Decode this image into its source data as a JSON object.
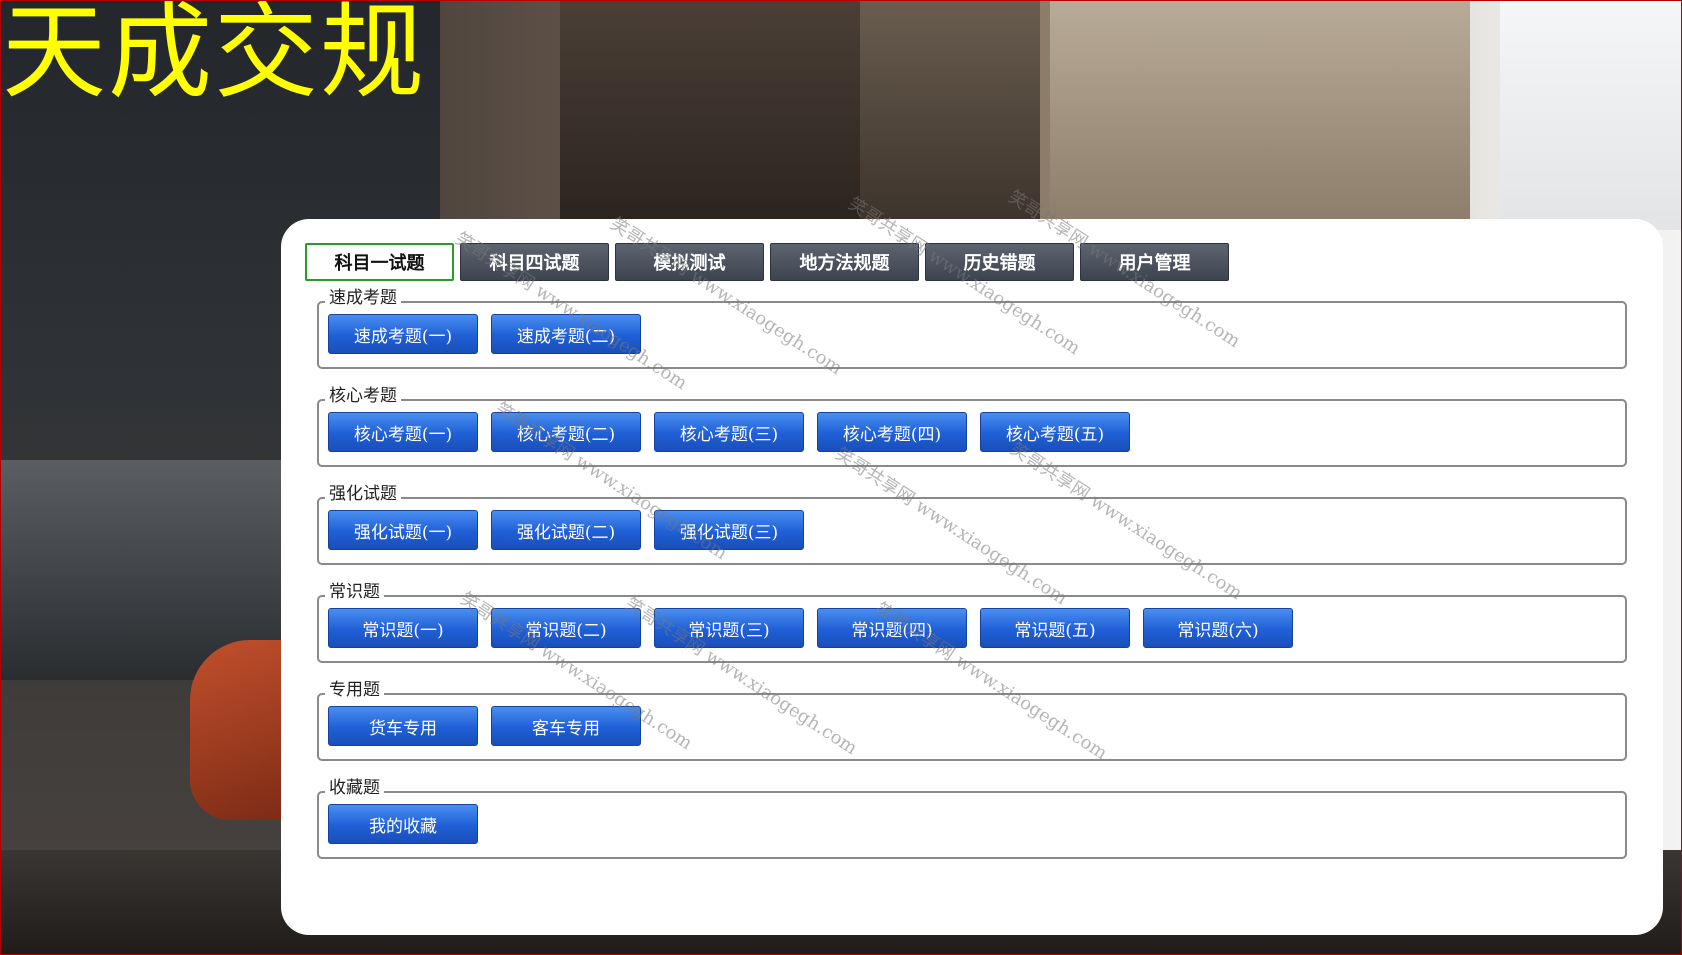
{
  "app": {
    "logo_text": "天成交规"
  },
  "tabs": [
    {
      "label": "科目一试题",
      "active": true
    },
    {
      "label": "科目四试题",
      "active": false
    },
    {
      "label": "模拟测试",
      "active": false
    },
    {
      "label": "地方法规题",
      "active": false
    },
    {
      "label": "历史错题",
      "active": false
    },
    {
      "label": "用户管理",
      "active": false
    }
  ],
  "groups": [
    {
      "legend": "速成考题",
      "buttons": [
        "速成考题(一)",
        "速成考题(二)"
      ]
    },
    {
      "legend": "核心考题",
      "buttons": [
        "核心考题(一)",
        "核心考题(二)",
        "核心考题(三)",
        "核心考题(四)",
        "核心考题(五)"
      ]
    },
    {
      "legend": "强化试题",
      "buttons": [
        "强化试题(一)",
        "强化试题(二)",
        "强化试题(三)"
      ]
    },
    {
      "legend": "常识题",
      "buttons": [
        "常识题(一)",
        "常识题(二)",
        "常识题(三)",
        "常识题(四)",
        "常识题(五)",
        "常识题(六)"
      ]
    },
    {
      "legend": "专用题",
      "buttons": [
        "货车专用",
        "客车专用"
      ]
    },
    {
      "legend": "收藏题",
      "buttons": [
        "我的收藏"
      ]
    }
  ],
  "watermark": {
    "text": "笑哥共享网 www.xiaogegh.com"
  },
  "colors": {
    "logo": "#ffff00",
    "tab_active_border": "#2a9c2a",
    "tab_bg": "#4a515c",
    "button_bg": "#2a6ae0",
    "group_border": "#8a8a8a"
  }
}
